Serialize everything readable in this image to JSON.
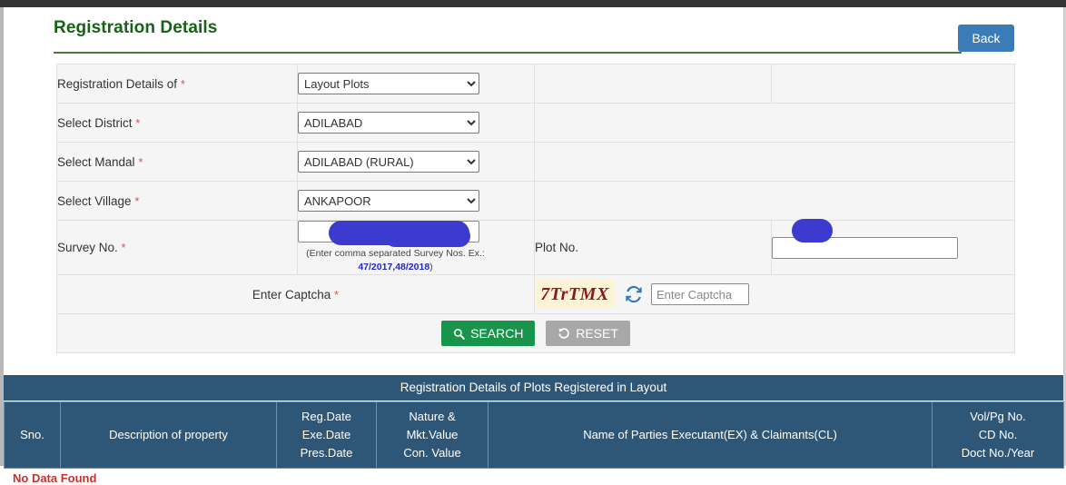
{
  "header": {
    "title": "Registration Details",
    "back_label": "Back",
    "title_color": "#186117",
    "back_bg": "#3b7cb8"
  },
  "form": {
    "rows": [
      {
        "label": "Registration Details of",
        "required": true,
        "control": "select",
        "value": "Layout Plots"
      },
      {
        "label": "Select District",
        "required": true,
        "control": "select",
        "value": "ADILABAD"
      },
      {
        "label": "Select Mandal",
        "required": true,
        "control": "select",
        "value": "ADILABAD (RURAL)"
      },
      {
        "label": "Select Village",
        "required": true,
        "control": "select",
        "value": "ANKAPOOR"
      }
    ],
    "survey": {
      "label": "Survey No.",
      "required": true,
      "value": "",
      "hint_text": "(Enter comma separated Survey Nos. Ex.:",
      "hint_example": "47/2017,48/2018",
      "hint_close": ")",
      "redacted": true
    },
    "plot": {
      "label": "Plot No.",
      "required": false,
      "value": "",
      "redacted": true
    },
    "captcha": {
      "label": "Enter Captcha",
      "required": true,
      "code": "7TrTMX",
      "code_color": "#8c1a1a",
      "background": "#fdf3d7",
      "input_value": "",
      "input_placeholder": "Enter Captcha",
      "refresh_icon": "refresh-icon",
      "refresh_color": "#2878c8"
    },
    "actions": {
      "search_label": "SEARCH",
      "search_icon": "search-icon",
      "search_color": "#18944b",
      "reset_label": "RESET",
      "reset_icon": "undo-icon",
      "reset_color": "#a8a8a8"
    }
  },
  "results": {
    "banner": "Registration Details of Plots Registered in Layout",
    "banner_color": "#2e5677",
    "columns": [
      "Sno.",
      "Description of property",
      "Reg.Date\nExe.Date\nPres.Date",
      "Nature &\nMkt.Value\nCon. Value",
      "Name of Parties Executant(EX) & Claimants(CL)",
      "Vol/Pg No.\nCD No.\nDoct No./Year"
    ],
    "columns_lines": {
      "c0": [
        "Sno."
      ],
      "c1": [
        "Description of property"
      ],
      "c2": [
        "Reg.Date",
        "Exe.Date",
        "Pres.Date"
      ],
      "c3": [
        "Nature &",
        "Mkt.Value",
        "Con. Value"
      ],
      "c4": [
        "Name of Parties Executant(EX) & Claimants(CL)"
      ],
      "c5": [
        "Vol/Pg No.",
        "CD No.",
        "Doct No./Year"
      ]
    },
    "no_data_message": "No Data Found"
  }
}
